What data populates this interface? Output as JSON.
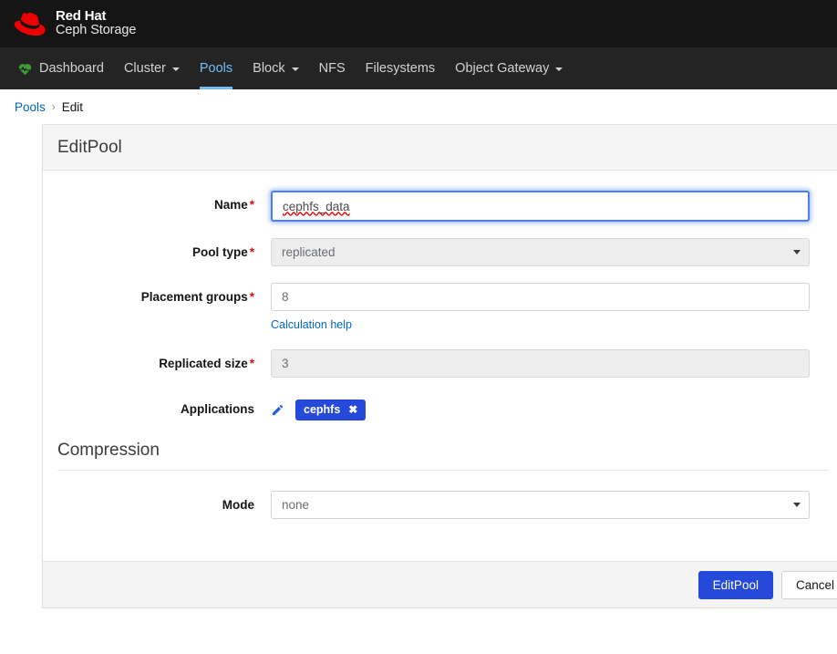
{
  "brand": {
    "logo_icon": "redhat-hat-icon",
    "line1": "Red Hat",
    "line2": "Ceph Storage"
  },
  "nav": {
    "dashboard_icon": "heartbeat-icon",
    "items": [
      {
        "label": "Dashboard",
        "caret": false,
        "active": false
      },
      {
        "label": "Cluster",
        "caret": true,
        "active": false
      },
      {
        "label": "Pools",
        "caret": false,
        "active": true
      },
      {
        "label": "Block",
        "caret": true,
        "active": false
      },
      {
        "label": "NFS",
        "caret": false,
        "active": false
      },
      {
        "label": "Filesystems",
        "caret": false,
        "active": false
      },
      {
        "label": "Object Gateway",
        "caret": true,
        "active": false
      }
    ],
    "active_color": "#73bcf7"
  },
  "breadcrumb": {
    "parent": "Pools",
    "separator": "›",
    "current": "Edit"
  },
  "card": {
    "title": "EditPool",
    "fields": {
      "name": {
        "label": "Name",
        "required_mark": "*",
        "value": "cephfs_data",
        "state": "focused"
      },
      "pool_type": {
        "label": "Pool type",
        "required_mark": "*",
        "value": "replicated",
        "state": "disabled",
        "caret_icon": "chevron-down-icon"
      },
      "placement_groups": {
        "label": "Placement groups",
        "required_mark": "*",
        "value": "8",
        "state": "enabled",
        "help_link": "Calculation help"
      },
      "replicated_size": {
        "label": "Replicated size",
        "required_mark": "*",
        "value": "3",
        "state": "disabled"
      },
      "applications": {
        "label": "Applications",
        "edit_icon": "pencil-icon",
        "badges": [
          {
            "label": "cephfs",
            "remove_icon": "close-icon",
            "remove_glyph": "✖",
            "color": "#2549d8"
          }
        ]
      }
    },
    "compression": {
      "section_title": "Compression",
      "mode": {
        "label": "Mode",
        "value": "none",
        "state": "enabled",
        "caret_icon": "chevron-down-icon"
      }
    }
  },
  "footer": {
    "submit_label": "EditPool",
    "cancel_label": "Cancel",
    "primary_color": "#2549d8"
  }
}
